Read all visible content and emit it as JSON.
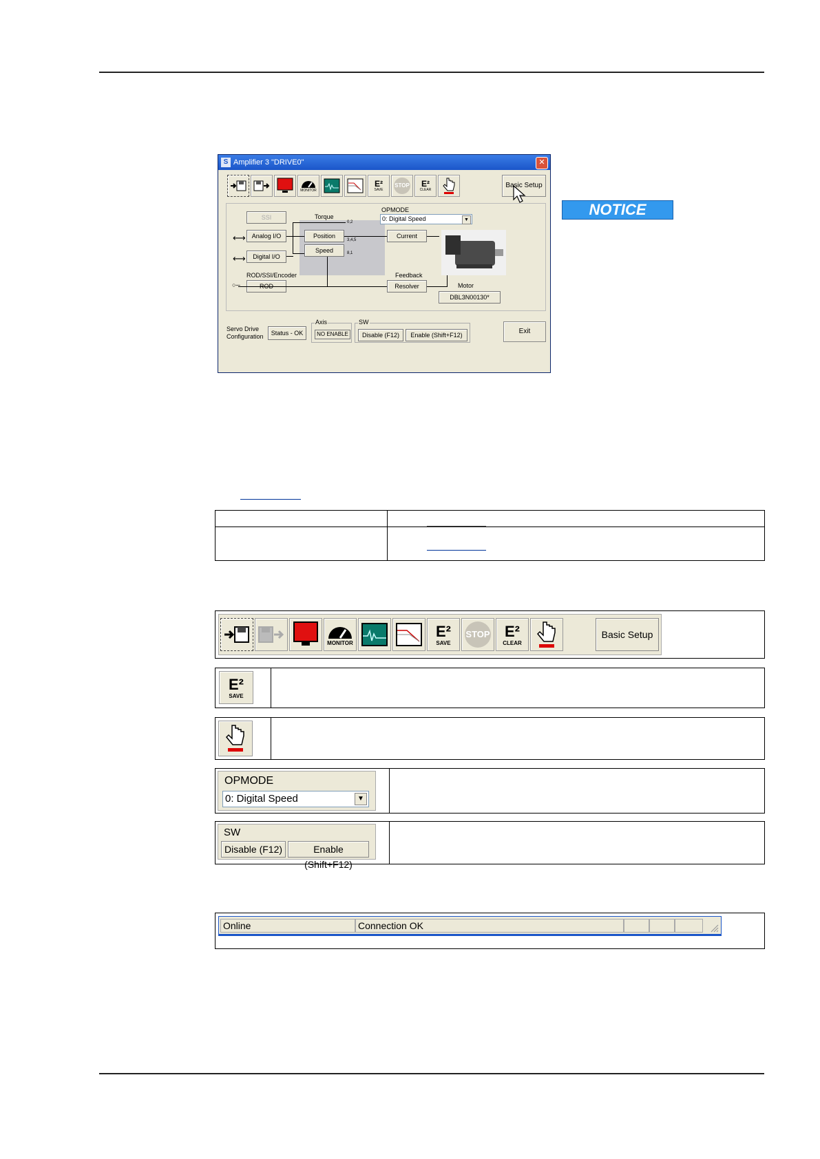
{
  "window": {
    "title": "Amplifier 3 \"DRIVE0\"",
    "app_icon": "S",
    "close_glyph": "✕",
    "basic_setup_label": "Basic Setup",
    "toolbar_small": {
      "monitor_label": "MONITOR",
      "save_label": "SAVE",
      "stop_label": "STOP",
      "clear_label": "CLEAR",
      "e2_label": "E²"
    },
    "opmode": {
      "label": "OPMODE",
      "value": "0: Digital Speed"
    },
    "diagram": {
      "ssi_button": "SSI",
      "analog_io": "Analog I/O",
      "digital_io": "Digital I/O",
      "encoder_label": "ROD/SSI/Encoder",
      "rod_button": "ROD",
      "torque_label": "Torque",
      "position_button": "Position",
      "speed_button": "Speed",
      "current_button": "Current",
      "feedback_label": "Feedback",
      "resolver_button": "Resolver",
      "motor_label": "Motor",
      "motor_button": "DBL3N00130*",
      "switch_labels": [
        "0,2",
        "3,4,5",
        "8,1"
      ]
    },
    "bottom": {
      "servo_config_line1": "Servo Drive",
      "servo_config_line2": "Configuration",
      "status_button": "Status - OK",
      "axis_label": "Axis",
      "axis_value": "NO ENABLE",
      "sw_label": "SW",
      "disable_button": "Disable (F12)",
      "enable_button": "Enable (Shift+F12)",
      "exit_button": "Exit"
    }
  },
  "notice": "NOTICE",
  "toolbar_large": {
    "monitor_label": "MONITOR",
    "save_label": "SAVE",
    "stop_label": "STOP",
    "clear_label": "CLEAR",
    "e2_label": "E²",
    "basic_setup_label": "Basic Setup"
  },
  "save_icon_row": {
    "save_label": "SAVE",
    "e2_label": "E²"
  },
  "opmode_panel": {
    "label": "OPMODE",
    "value": "0: Digital Speed"
  },
  "sw_panel": {
    "label": "SW",
    "disable": "Disable (F12)",
    "enable": "Enable (Shift+F12)"
  },
  "status_bar": {
    "mode": "Online",
    "connection": "Connection OK"
  }
}
